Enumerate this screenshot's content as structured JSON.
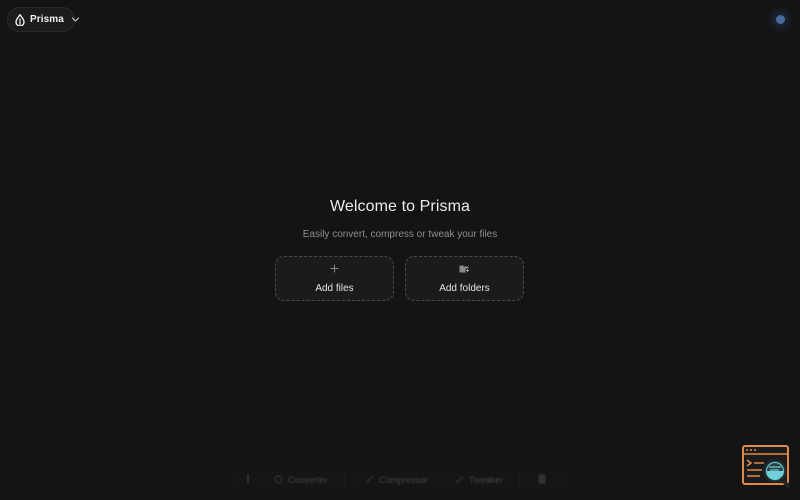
{
  "header": {
    "app_name": "Prisma",
    "logo_icon": "droplet-icon",
    "switcher_icon": "chevron-down-icon"
  },
  "welcome": {
    "title": "Welcome to Prisma",
    "subtitle": "Easily convert, compress or tweak your files"
  },
  "actions": {
    "add_files": {
      "label": "Add files",
      "icon": "plus-icon"
    },
    "add_folders": {
      "label": "Add folders",
      "icon": "folder-add-icon"
    }
  },
  "dock": {
    "convert_label": "Converter",
    "compress_label": "Compressor",
    "tweak_label": "Tweaker"
  },
  "colors": {
    "background": "#141414",
    "card_border": "#4a4a4a",
    "status_dot": "#4a6a9a",
    "widget_accent": "#e08a4a",
    "widget_magnifier": "#6fd0d8"
  }
}
